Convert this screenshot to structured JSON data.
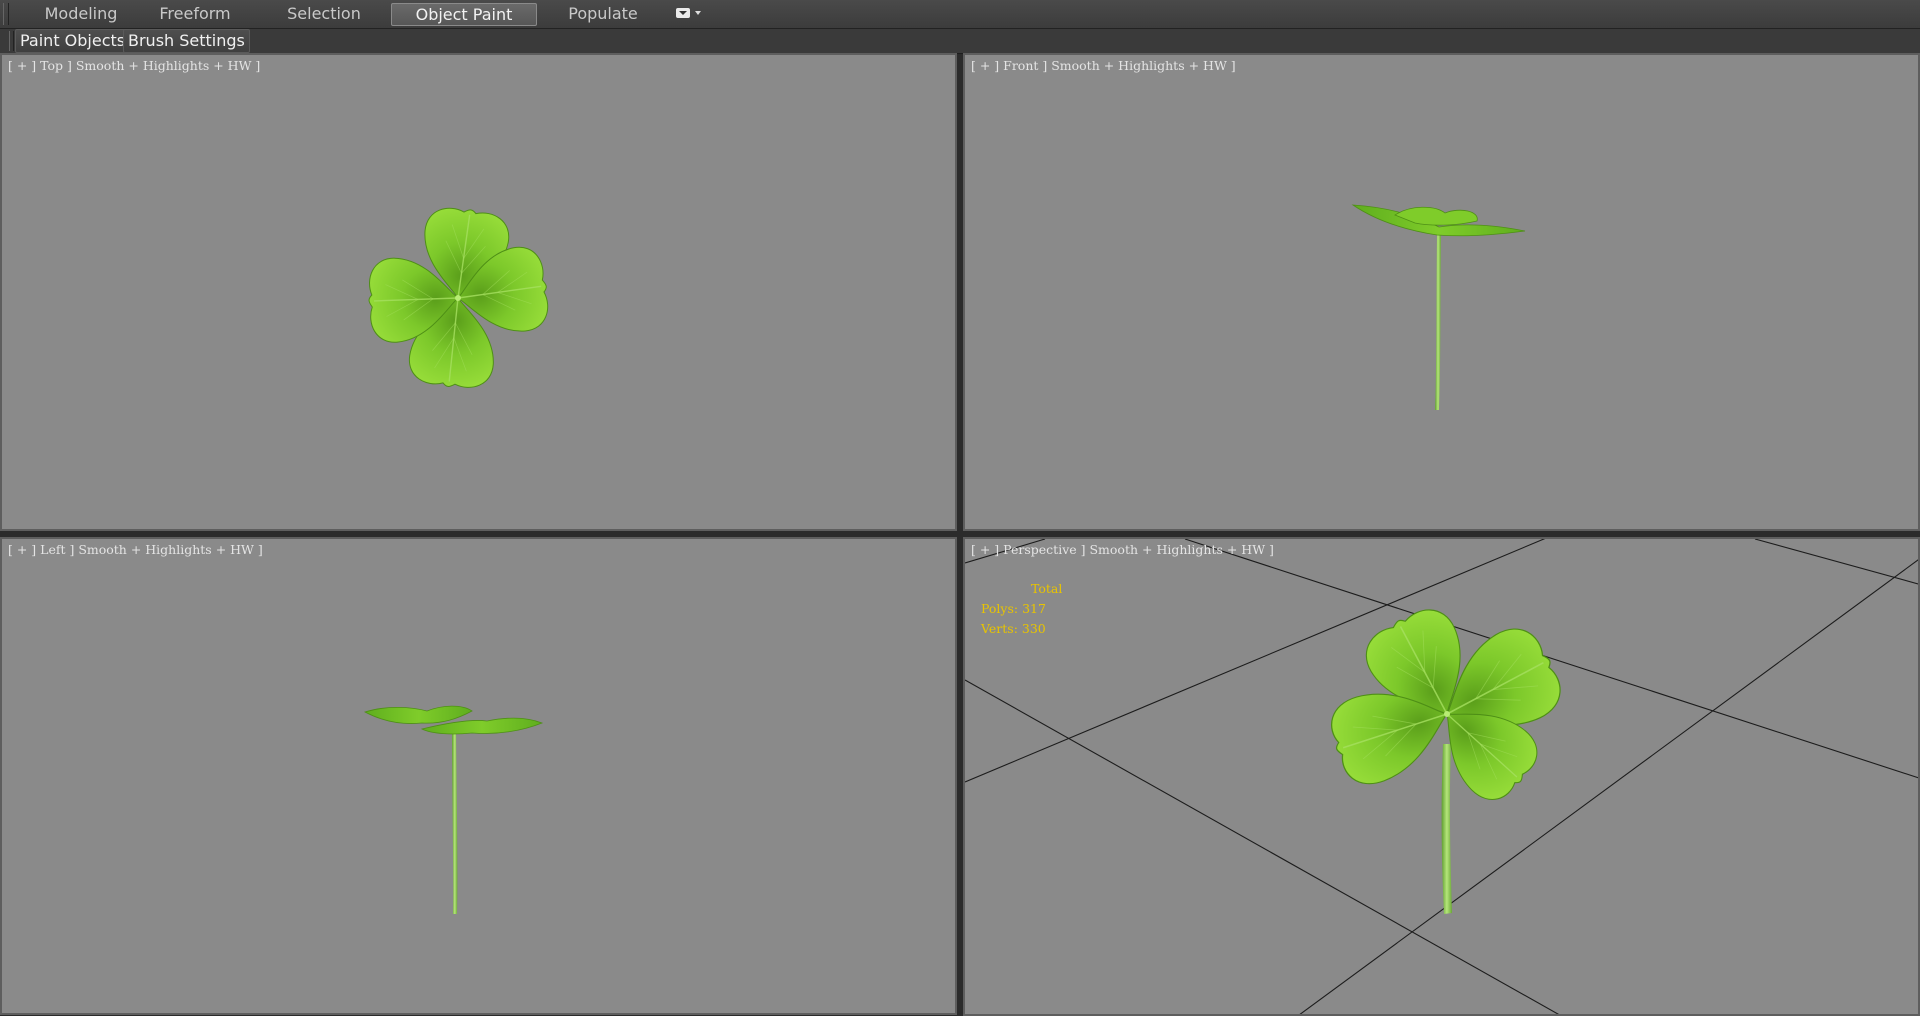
{
  "ribbon": {
    "tabs": [
      {
        "label": "Modeling"
      },
      {
        "label": "Freeform"
      },
      {
        "label": "Selection"
      },
      {
        "label": "Object Paint",
        "active": true
      },
      {
        "label": "Populate"
      }
    ],
    "menu_icon": "ribbon-options-icon"
  },
  "subbar": {
    "paint_objects": "Paint Objects",
    "brush_settings": "Brush Settings"
  },
  "viewports": {
    "top": {
      "label": "[ + ] Top ] Smooth + Highlights + HW ]"
    },
    "front": {
      "label": "[ + ] Front ] Smooth + Highlights + HW ]"
    },
    "left": {
      "label": "[ + ] Left ] Smooth + Highlights + HW ]"
    },
    "perspective": {
      "label": "[ + ] Perspective ] Smooth + Highlights + HW ]",
      "stats": {
        "total": "Total",
        "polys": "Polys: 317",
        "verts": "Verts: 330"
      }
    }
  },
  "colors": {
    "viewport_bg": "#8a8a8a",
    "leaf_light": "#8fdc35",
    "leaf_dark": "#4f9a16",
    "stats_text": "#e8c400",
    "grid_line": "#1c1c1c"
  }
}
